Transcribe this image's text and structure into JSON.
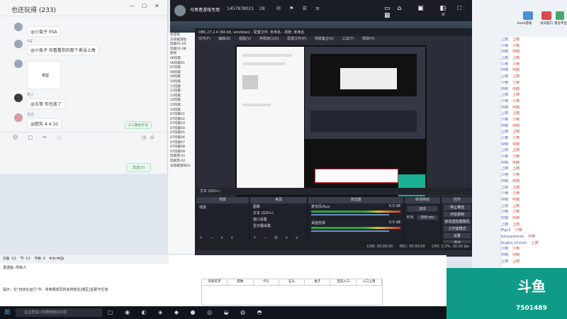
{
  "chat": {
    "title": "也还玩得 (233)",
    "messages": [
      {
        "text": "@小兔子 05A"
      },
      {
        "name": "T哥",
        "text": "@小兔子 你看看你的那个表没上角"
      },
      {
        "name": "",
        "text": "类型"
      },
      {
        "name": "老人",
        "text": "@古哥 你也放了"
      },
      {
        "name": "也还",
        "text": "@肥灰 4.4.10"
      }
    ],
    "invite_button": "2人接收字谷",
    "send_button": "发送(S)"
  },
  "stream": {
    "app_title": "马哥者游戏专用",
    "id": "1457878021",
    "count": "28"
  },
  "obs": {
    "title": "OBS 27.2.4 (64-bit, windows) - 配置文件: 未命名 - 场景: 未命名",
    "menu": [
      "文件(F)",
      "编辑(E)",
      "视图(V)",
      "停靠窗口(D)",
      "配置文件(P)",
      "场景集合(S)",
      "工具(T)",
      "帮助(H)"
    ],
    "source_bar": "文本 (GDI+)",
    "scenes_header": "场景",
    "scenes": [
      "场景"
    ],
    "sources_header": "来源",
    "sources": [
      "图像",
      "文本 (GDI+)",
      "窗口采集",
      "显示器采集"
    ],
    "mixer_header": "混音器",
    "mixer": [
      {
        "name": "桌面音频",
        "db": "0.0 dB"
      },
      {
        "name": "麦克风/Aux",
        "db": "0.0 dB"
      }
    ],
    "transition_header": "转场特效",
    "transition": {
      "type": "淡出",
      "duration_label": "时长",
      "duration": "300 ms"
    },
    "controls_header": "控件",
    "controls": [
      "停止推流",
      "开始录制",
      "启动虚拟摄像机",
      "工作室模式",
      "设置",
      "退出"
    ],
    "status": {
      "live": "LIVE: 00:00:00",
      "rec": "REC: 00:00:00",
      "cpu": "CPU: 3.3%, 30.00 fps"
    }
  },
  "tree": {
    "items": [
      "也还玩",
      "马哥者游戏",
      "玩家01-05",
      "玩家01-08",
      "影视",
      "06玩家",
      "06玩家01",
      "07玩家",
      "08玩家",
      "09玩家",
      "10玩家",
      "11玩家",
      "12玩家",
      "13玩家",
      "14玩家",
      "15玩家",
      "16玩家",
      "07玩家01",
      "07玩家02",
      "07玩家03",
      "07玩家04",
      "07玩家05",
      "07玩家06",
      "07玩家07",
      "07玩家08",
      "07玩家09",
      "玩家西-01",
      "玩家西-02",
      "马哥者游戏01"
    ]
  },
  "right": {
    "icons": [
      "Kaim游戏",
      "访问窗口",
      "意见平台"
    ],
    "counter": "29",
    "entries": [
      {
        "name": "上岗",
        "pos": "上岗"
      },
      {
        "name": "少用",
        "pos": "少用"
      },
      {
        "name": "中岗",
        "pos": "中岗"
      },
      {
        "name": "上岗",
        "pos": "上岗"
      },
      {
        "name": "少用",
        "pos": "少用"
      },
      {
        "name": "中岗",
        "pos": "中岗"
      },
      {
        "name": "上岗",
        "pos": "上岗"
      },
      {
        "name": "少用",
        "pos": "少用"
      },
      {
        "name": "中岗",
        "pos": "中岗"
      },
      {
        "name": "上岗",
        "pos": "上岗"
      },
      {
        "name": "少用",
        "pos": "少用"
      },
      {
        "name": "中岗",
        "pos": "中岗"
      },
      {
        "name": "上岗",
        "pos": "上岗"
      },
      {
        "name": "少用",
        "pos": "少用"
      },
      {
        "name": "中岗",
        "pos": "中岗"
      },
      {
        "name": "上岗",
        "pos": "上岗"
      },
      {
        "name": "少用",
        "pos": "少用"
      },
      {
        "name": "中岗",
        "pos": "中岗"
      },
      {
        "name": "上岗",
        "pos": "上岗"
      },
      {
        "name": "少用",
        "pos": "少用"
      },
      {
        "name": "中岗",
        "pos": "中岗"
      },
      {
        "name": "上岗",
        "pos": "上岗"
      },
      {
        "name": "少用",
        "pos": "少用"
      },
      {
        "name": "中岗",
        "pos": "中岗"
      },
      {
        "name": "上岗",
        "pos": "上岗"
      },
      {
        "name": "少用",
        "pos": "少用"
      },
      {
        "name": "中岗",
        "pos": "中岗"
      },
      {
        "name": "上岗",
        "pos": "上岗"
      },
      {
        "name": "少用",
        "pos": "少用"
      },
      {
        "name": "中岗",
        "pos": "中岗"
      },
      {
        "name": "上岗",
        "pos": "上岗"
      },
      {
        "name": "Elgz2",
        "pos": "少用"
      },
      {
        "name": "baisupiseces",
        "pos": "中岗"
      },
      {
        "name": "bugtui_chunzn",
        "pos": "上岗"
      },
      {
        "name": "少用",
        "pos": "少用"
      },
      {
        "name": "中岗",
        "pos": "中岗"
      },
      {
        "name": "上岗",
        "pos": "上岗"
      }
    ]
  },
  "editor": {
    "page": "页面: 1/1",
    "section": "节: 1/1",
    "words": "字数: 0",
    "lang": "中文(中国)",
    "send_to": "发送给: 所有人",
    "reminder": "提示：在\"自动化运行\"中，将参赛成员的名称放在[赛区]后即可生效",
    "headers": [
      "玩家名字",
      "客数",
      "卡头",
      "石头",
      "金子",
      "当前入口",
      "入口上限"
    ]
  },
  "taskbar": {
    "search_placeholder": "在这里输入你要搜索的内容"
  },
  "watermark": {
    "logo": "斗鱼",
    "number": "7501489"
  }
}
